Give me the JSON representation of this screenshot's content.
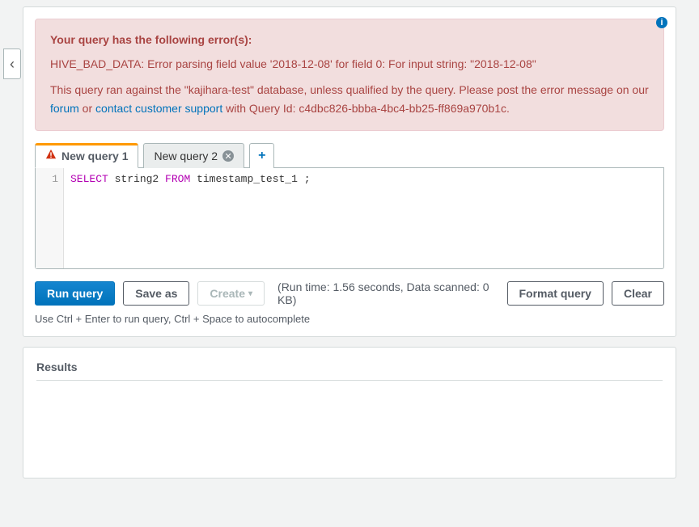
{
  "error": {
    "heading": "Your query has the following error(s):",
    "message": "HIVE_BAD_DATA: Error parsing field value '2018-12-08' for field 0: For input string: \"2018-12-08\"",
    "context_pre": "This query ran against the \"kajihara-test\" database, unless qualified by the query. Please post the error message on our ",
    "forum_label": "forum",
    "context_mid": " or ",
    "support_label": "contact customer support",
    "context_post": " with Query Id: c4dbc826-bbba-4bc4-bb25-ff869a970b1c."
  },
  "tabs": [
    {
      "label": "New query 1"
    },
    {
      "label": "New query 2"
    }
  ],
  "editor": {
    "line_no": "1",
    "kw_select": "SELECT",
    "col": "string2",
    "kw_from": "FROM",
    "table": "timestamp_test_1",
    "term": " ;"
  },
  "buttons": {
    "run": "Run query",
    "save_as": "Save as",
    "create": "Create",
    "format": "Format query",
    "clear": "Clear"
  },
  "run_info": "(Run time: 1.56 seconds, Data scanned: 0 KB)",
  "hint": "Use Ctrl + Enter to run query, Ctrl + Space to autocomplete",
  "results": {
    "title": "Results"
  }
}
